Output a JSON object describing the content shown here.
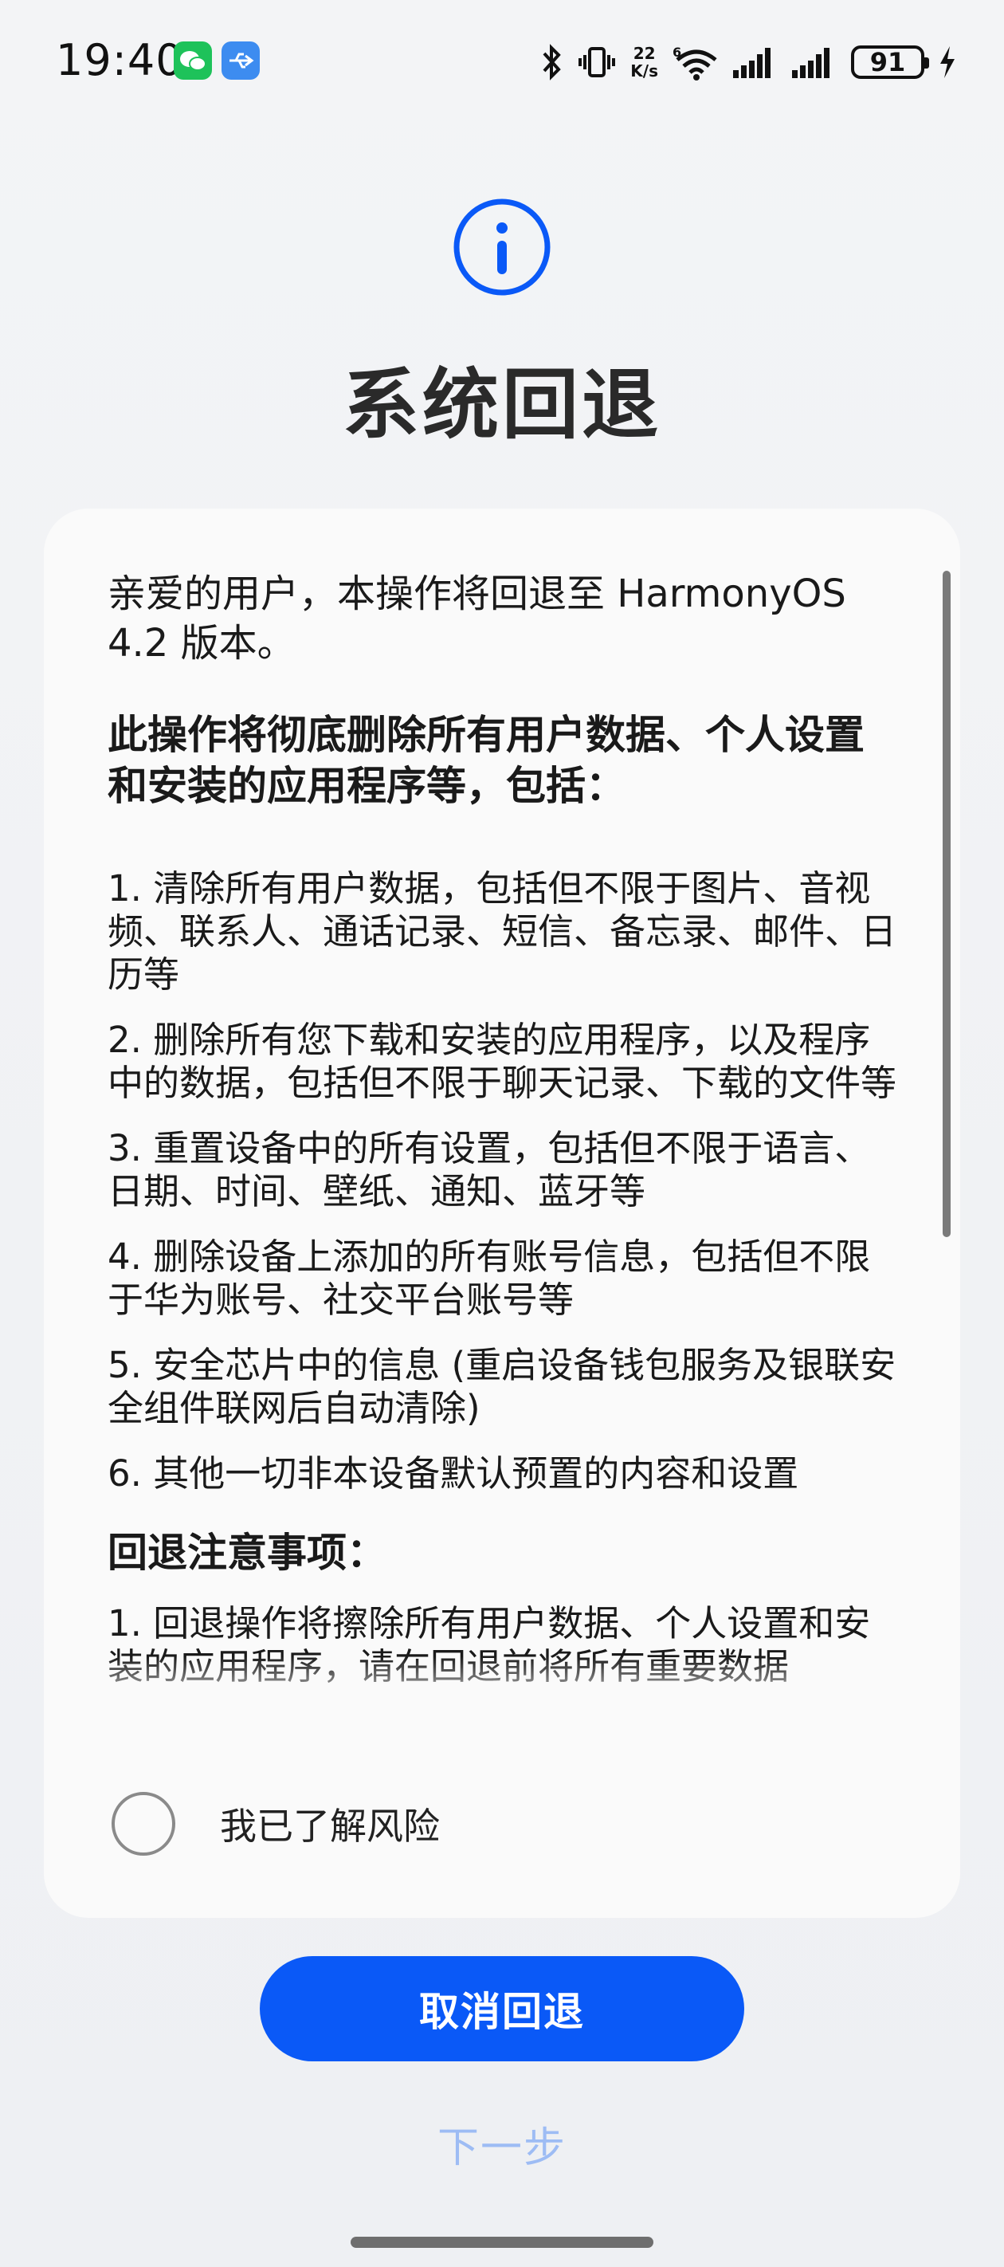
{
  "status_bar": {
    "time": "19:40",
    "speed_value": "22",
    "speed_unit": "K/s",
    "battery": "91",
    "icons": [
      "wechat-icon",
      "usb-icon",
      "bluetooth-icon",
      "vibrate-icon",
      "network-speed",
      "wifi-icon",
      "signal-icon",
      "signal-icon",
      "battery-icon",
      "charging-icon"
    ]
  },
  "header": {
    "icon": "info-icon",
    "title": "系统回退"
  },
  "content": {
    "intro": "亲爱的用户，本操作将回退至 HarmonyOS 4.2 版本。",
    "heading": "此操作将彻底删除所有用户数据、个人设置和安装的应用程序等，包括：",
    "items": [
      "1. 清除所有用户数据，包括但不限于图片、音视频、联系人、通话记录、短信、备忘录、邮件、日历等",
      "2. 删除所有您下载和安装的应用程序，以及程序中的数据，包括但不限于聊天记录、下载的文件等",
      "3. 重置设备中的所有设置，包括但不限于语言、日期、时间、壁纸、通知、蓝牙等",
      "4. 删除设备上添加的所有账号信息，包括但不限于华为账号、社交平台账号等",
      "5. 安全芯片中的信息 (重启设备钱包服务及银联安全组件联网后自动清除)",
      "6. 其他一切非本设备默认预置的内容和设置"
    ],
    "notes_heading": "回退注意事项：",
    "notes": [
      "1. 回退操作将擦除所有用户数据、个人设置和安装的应用程序，请在回退前将所有重要数据"
    ]
  },
  "agree": {
    "label": "我已了解风险",
    "checked": false
  },
  "buttons": {
    "cancel": "取消回退",
    "next": "下一步"
  },
  "colors": {
    "accent": "#0a59f7",
    "disabled_text": "#9dbcf4",
    "background": "#f1f3f5",
    "card": "#fafafa"
  }
}
